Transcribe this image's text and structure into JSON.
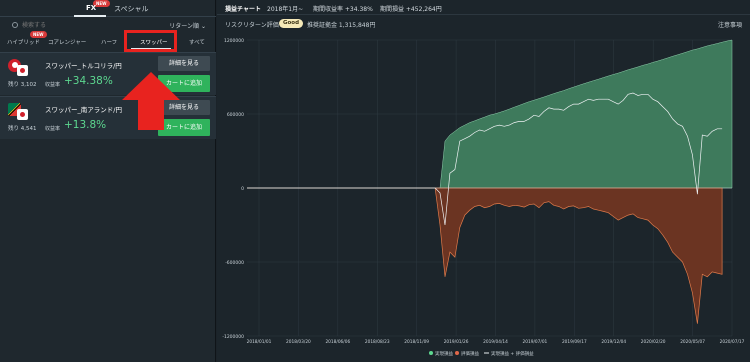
{
  "sidebar": {
    "tabs": {
      "fx": "FX",
      "special": "スペシャル",
      "new_badge": "NEW"
    },
    "search_placeholder": "検索する",
    "return_sort": "リターン順",
    "categories": [
      "ハイブリッド",
      "コアレンジャー",
      "ハーフ",
      "スワッパー",
      "すべて"
    ],
    "items": [
      {
        "name": "スワッパー_トルコリラ/円",
        "remaining": "残り 3,102",
        "return_label": "収益率",
        "return_value": "+34.38%",
        "detail_label": "詳細を見る",
        "cart_label": "カートに追加"
      },
      {
        "name": "スワッパー_南アランド/円",
        "remaining": "残り 4,541",
        "return_label": "収益率",
        "return_value": "+13.8%",
        "detail_label": "詳細を見る",
        "cart_label": "カートに追加"
      }
    ]
  },
  "main": {
    "title": "損益チャート",
    "period_select": "2018年1月~",
    "period_return": "期間収益率 +34.38%",
    "period_pl": "期間損益 +452,264円",
    "risk_return_label": "リスクリターン評価",
    "rating": "Good",
    "required_margin": "推奨証拠金 1,315,848円",
    "notes": "注意事項"
  },
  "colors": {
    "accent_red": "#e8231f",
    "positive": "#5dd890",
    "realized_fill": "#3e7a5c",
    "unrealized_fill": "#6b3422",
    "cart_green": "#2fb35c"
  },
  "chart_data": {
    "type": "area",
    "x_ticks": [
      "2018/01/01",
      "2018/03/20",
      "2018/06/06",
      "2018/08/23",
      "2018/11/09",
      "2019/01/26",
      "2019/04/14",
      "2019/07/01",
      "2019/09/17",
      "2019/12/04",
      "2020/02/20",
      "2020/05/07",
      "2020/07/17"
    ],
    "y_ticks": [
      1200000,
      600000,
      0,
      -600000,
      -1200000
    ],
    "ylim": [
      -1200000,
      1200000
    ],
    "legend": [
      "実現損益",
      "評価損益",
      "実現損益 + 評価損益"
    ],
    "legend_position": "bottom",
    "series": [
      {
        "name": "実現損益",
        "values": [
          0,
          0,
          0,
          0,
          0,
          0,
          0,
          0,
          0,
          0,
          0,
          0,
          0,
          0,
          0,
          0,
          0,
          0,
          0,
          0,
          0,
          0,
          0,
          0,
          0,
          0,
          0,
          0,
          0,
          0,
          0,
          0,
          0,
          0,
          0,
          0,
          0,
          0,
          0,
          0,
          380000,
          430000,
          460000,
          490000,
          510000,
          530000,
          545000,
          560000,
          575000,
          590000,
          600000,
          612000,
          625000,
          640000,
          655000,
          670000,
          685000,
          700000,
          712000,
          725000,
          738000,
          752000,
          765000,
          778000,
          790000,
          805000,
          818000,
          832000,
          845000,
          858000,
          870000,
          882000,
          895000,
          908000,
          920000,
          932000,
          945000,
          958000,
          970000,
          982000,
          995000,
          1005000,
          1018000,
          1030000,
          1042000,
          1055000,
          1068000,
          1080000,
          1092000,
          1105000,
          1118000,
          1128000,
          1140000,
          1152000,
          1162000,
          1172000,
          1182000,
          1192000,
          1200000
        ]
      },
      {
        "name": "評価損益",
        "values": [
          0,
          0,
          0,
          0,
          0,
          0,
          0,
          0,
          0,
          0,
          0,
          0,
          0,
          0,
          0,
          0,
          0,
          0,
          0,
          0,
          0,
          0,
          0,
          0,
          0,
          0,
          0,
          0,
          0,
          0,
          0,
          0,
          0,
          0,
          0,
          0,
          0,
          0,
          0,
          -300000,
          -720000,
          -520000,
          -560000,
          -320000,
          -220000,
          -180000,
          -150000,
          -140000,
          -160000,
          -150000,
          -130000,
          -125000,
          -140000,
          -150000,
          -140000,
          -145000,
          -155000,
          -135000,
          -130000,
          -160000,
          -120000,
          -110000,
          -140000,
          -150000,
          -170000,
          -150000,
          -145000,
          -165000,
          -160000,
          -150000,
          -170000,
          -180000,
          -190000,
          -200000,
          -230000,
          -260000,
          -240000,
          -220000,
          -210000,
          -240000,
          -250000,
          -260000,
          -300000,
          -330000,
          -380000,
          -440000,
          -520000,
          -560000,
          -600000,
          -700000,
          -850000,
          -1100000,
          -700000,
          -720000,
          -680000,
          -690000,
          -700000
        ]
      },
      {
        "name": "実現損益 + 評価損益",
        "values": [
          0,
          0,
          0,
          0,
          0,
          0,
          0,
          0,
          0,
          0,
          0,
          0,
          0,
          0,
          0,
          0,
          0,
          0,
          0,
          0,
          0,
          0,
          0,
          0,
          0,
          0,
          0,
          0,
          0,
          0,
          0,
          0,
          0,
          0,
          0,
          0,
          0,
          0,
          0,
          -40000,
          -300000,
          120000,
          150000,
          380000,
          400000,
          420000,
          450000,
          470000,
          460000,
          480000,
          500000,
          510000,
          500000,
          510000,
          530000,
          540000,
          540000,
          560000,
          590000,
          580000,
          620000,
          650000,
          640000,
          640000,
          630000,
          660000,
          680000,
          680000,
          700000,
          720000,
          710000,
          720000,
          720000,
          720000,
          700000,
          680000,
          710000,
          760000,
          770000,
          750000,
          760000,
          760000,
          720000,
          700000,
          660000,
          620000,
          560000,
          520000,
          500000,
          420000,
          270000,
          -50000,
          430000,
          420000,
          460000,
          480000,
          480000
        ]
      }
    ]
  }
}
